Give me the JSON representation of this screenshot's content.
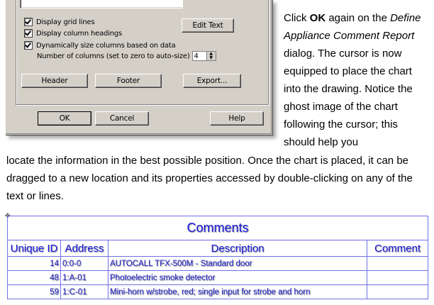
{
  "dialog": {
    "checkboxes": [
      {
        "label": "Display grid lines",
        "checked": true
      },
      {
        "label": "Display column headings",
        "checked": true
      },
      {
        "label": "Dynamically size columns based on data",
        "checked": true
      }
    ],
    "num_columns_label": "Number of columns (set to zero to auto-size)",
    "num_columns_value": "4",
    "edit_text_button": "Edit Text",
    "header_button": "Header",
    "footer_button": "Footer",
    "export_button": "Export...",
    "ok_button": "OK",
    "cancel_button": "Cancel",
    "help_button": "Help"
  },
  "instructions": {
    "p1": "Click ",
    "ok": "OK",
    "p2": " again on the ",
    "dialog_name": "Define Appliance Comment Report",
    "p3": " dialog. The cursor is now equipped to place the chart into the drawing. Notice the ghost image of the chart following the cursor; this should help you",
    "p4": "locate the information in the best possible position. Once the chart is placed, it can be dragged to a new location and its properties accessed by double-clicking on any of the text or lines."
  },
  "table": {
    "title": "Comments",
    "headers": [
      "Unique ID",
      "Address",
      "Description",
      "Comment"
    ],
    "rows": [
      {
        "id": "14",
        "address": "0:0-0",
        "description": "AUTOCALL TFX-500M - Standard door",
        "comment": ""
      },
      {
        "id": "48",
        "address": "1:A-01",
        "description": "Photoelectric smoke detector",
        "comment": ""
      },
      {
        "id": "59",
        "address": "1:C-01",
        "description": "Mini-horn w/strobe, red; single input for strobe and horn",
        "comment": ""
      }
    ]
  }
}
